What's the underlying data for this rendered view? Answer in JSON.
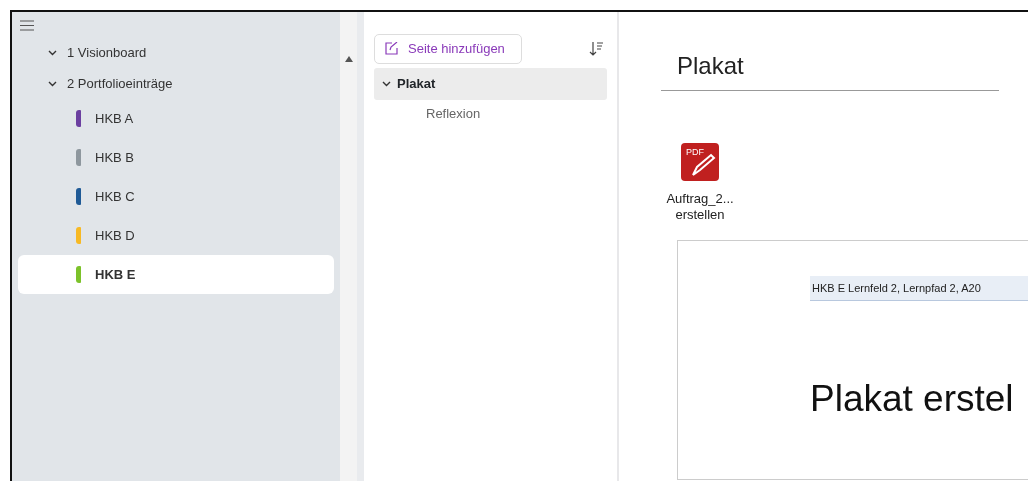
{
  "section_groups": [
    {
      "label": "1 Visionboard",
      "expanded": true
    },
    {
      "label": "2 Portfolioeinträge",
      "expanded": true
    }
  ],
  "sections": [
    {
      "label": "HKB A",
      "color": "#6b3fa0",
      "selected": false
    },
    {
      "label": "HKB B",
      "color": "#8e979e",
      "selected": false
    },
    {
      "label": "HKB C",
      "color": "#1f5a96",
      "selected": false
    },
    {
      "label": "HKB D",
      "color": "#f7b924",
      "selected": false
    },
    {
      "label": "HKB E",
      "color": "#7cc22a",
      "selected": true
    }
  ],
  "add_page_button": "Seite hinzufügen",
  "pages": [
    {
      "label": "Plakat",
      "selected": true,
      "expanded": true,
      "children": [
        {
          "label": "Reflexion",
          "selected": false
        }
      ]
    }
  ],
  "page_title": "Plakat",
  "attachment": {
    "icon_text": "PDF",
    "name": "Auftrag_2...",
    "name_line2": "erstellen"
  },
  "document": {
    "header": "HKB E Lernfeld 2, Lernpfad 2, A20",
    "heading": "Plakat erstel"
  }
}
